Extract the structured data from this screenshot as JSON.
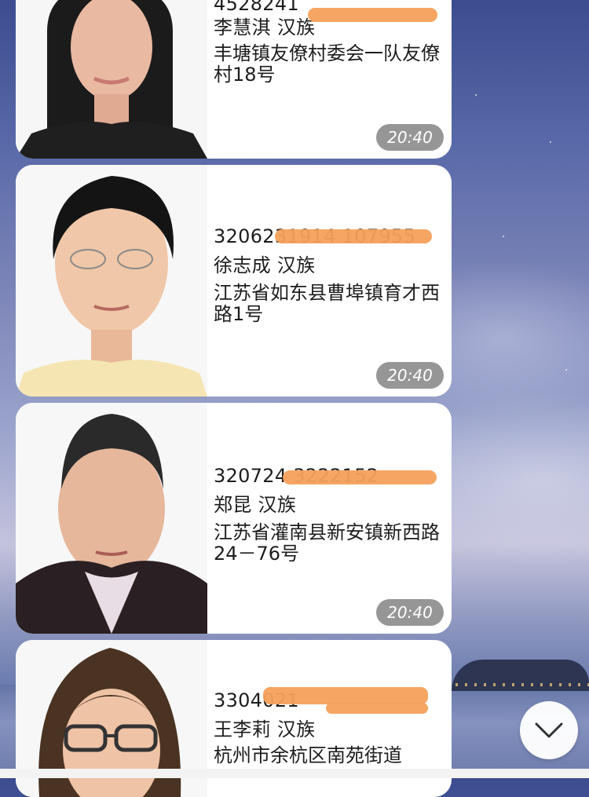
{
  "messages": [
    {
      "id_number": "4528241",
      "name_ethnicity": "李慧淇 汉族",
      "address": "丰塘镇友僚村委会一队友僚村18号",
      "time": "20:40"
    },
    {
      "id_number": "3206231914 107955",
      "name_ethnicity": "徐志成 汉族",
      "address": "江苏省如东县曹埠镇育才西路1号",
      "time": "20:40"
    },
    {
      "id_number": "320724 3222152",
      "name_ethnicity": "郑昆 汉族",
      "address": "江苏省灌南县新安镇新西路24－76号",
      "time": "20:40"
    },
    {
      "id_number": "3304021",
      "name_ethnicity": "王李莉 汉族",
      "address": "杭州市余杭区南苑街道",
      "time": ""
    }
  ],
  "scroll_button": {
    "icon": "chevron-down-icon"
  },
  "colors": {
    "bubble": "#ffffff",
    "redaction": "#f5a05b",
    "time_pill": "#787878"
  }
}
